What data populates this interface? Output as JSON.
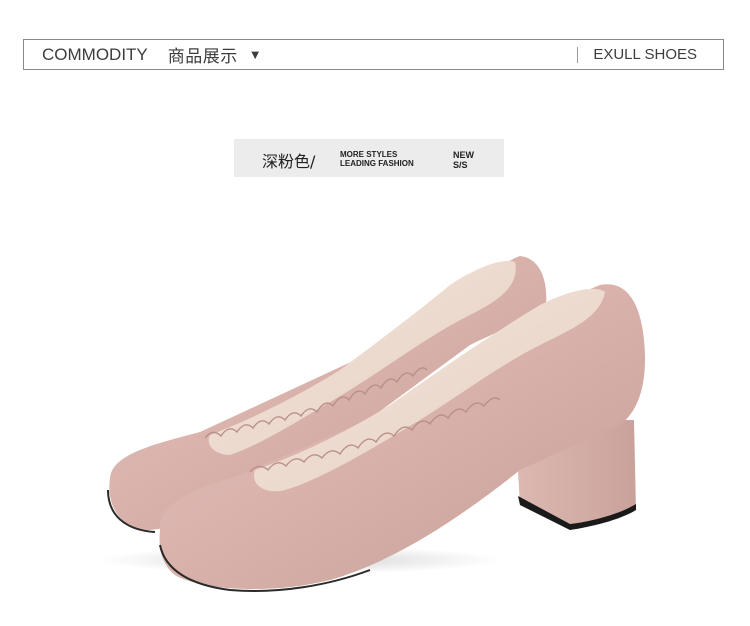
{
  "header": {
    "title_en": "COMMODITY",
    "title_cn": "商品展示",
    "caret": "▼",
    "brand": "EXULL SHOES"
  },
  "color_tag": {
    "color_name": "深粉色/",
    "tagline_line1": "MORE STYLES",
    "tagline_line2": "LEADING FASHION",
    "badge_line1": "NEW",
    "badge_line2": "S/S"
  },
  "product": {
    "icon": "pink-suede-pump-pair",
    "colors": {
      "suede": "#d9b3ad",
      "suede_shadow": "#c29c96",
      "lining": "#efddd1",
      "heel_shadow": "#1a1a1a"
    }
  }
}
